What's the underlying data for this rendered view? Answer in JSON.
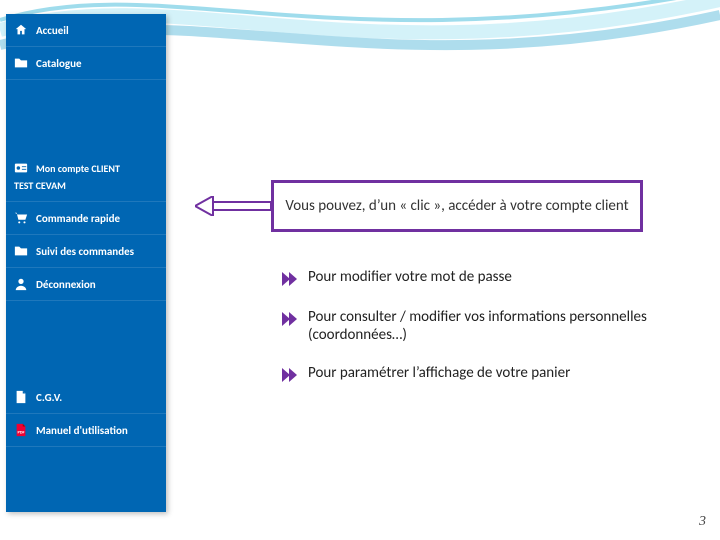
{
  "colors": {
    "brand_blue": "#0066b3",
    "accent_purple": "#7030a0",
    "wave1": "#9ad4e8",
    "wave2": "#c2ecf6"
  },
  "sidebar": {
    "items": [
      {
        "label": "Accueil",
        "icon": "home-icon"
      },
      {
        "label": "Catalogue",
        "icon": "folder-icon"
      },
      {
        "label_line1": "Mon compte CLIENT",
        "label_line2": "TEST CEVAM",
        "icon": "user-card-icon"
      },
      {
        "label": "Commande rapide",
        "icon": "cart-icon"
      },
      {
        "label": "Suivi des commandes",
        "icon": "folder-icon"
      },
      {
        "label": "Déconnexion",
        "icon": "user-icon"
      },
      {
        "label": "C.G.V.",
        "icon": "doc-icon"
      },
      {
        "label": "Manuel d'utilisation",
        "icon": "pdf-icon"
      }
    ]
  },
  "callout": {
    "text": "Vous pouvez, d’un « clic », accéder à votre compte client"
  },
  "bullets": [
    "Pour modifier votre mot de passe",
    "Pour consulter / modifier  vos informations personnelles (coordonnées…)",
    "Pour paramétrer  l’affichage de votre panier"
  ],
  "page_number": "3"
}
